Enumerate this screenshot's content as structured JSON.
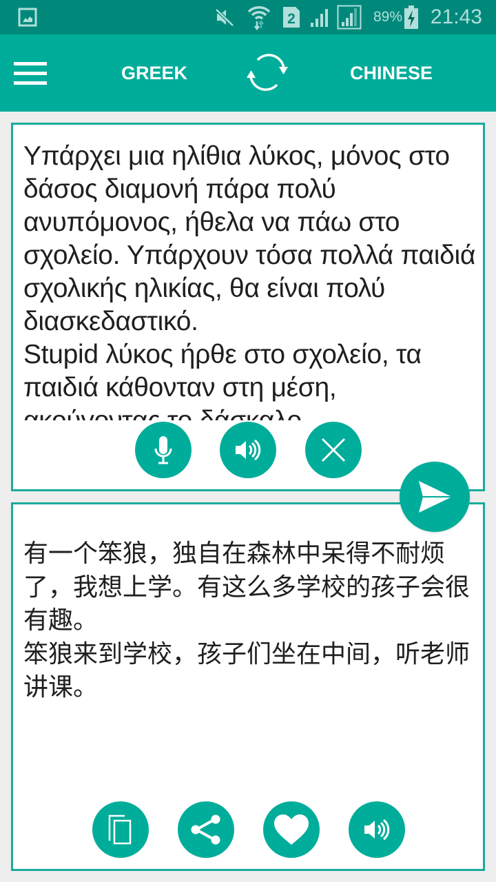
{
  "status_bar": {
    "notification_icon": "gallery-icon",
    "icons": [
      "mute-icon",
      "wifi-icon",
      "sim2-icon",
      "signal-icon",
      "signal-icon"
    ],
    "sim_label": "2",
    "battery_percent": "89%",
    "battery_icon": "battery-charging-icon",
    "time": "21:43"
  },
  "app_bar": {
    "menu_icon": "hamburger-menu-icon",
    "source_language": "GREEK",
    "swap_icon": "swap-languages-icon",
    "target_language": "CHINESE"
  },
  "source_panel": {
    "text": "Υπάρχει μια ηλίθια λύκος, μόνος στο δάσος διαμονή πάρα πολύ ανυπόμονος, ήθελα να πάω στο σχολείο. Υπάρχουν τόσα πολλά παιδιά σχολικής ηλικίας, θα είναι πολύ διασκεδαστικό.\nStupid λύκος ήρθε στο σχολείο, τα παιδιά κάθονταν στη μέση, ακούγοντας το δάσκαλο.",
    "buttons": [
      {
        "name": "microphone",
        "icon": "microphone-icon"
      },
      {
        "name": "speak-source",
        "icon": "speaker-icon"
      },
      {
        "name": "clear",
        "icon": "close-icon"
      }
    ]
  },
  "translate_button": {
    "icon": "send-icon"
  },
  "target_panel": {
    "text": "有一个笨狼，独自在森林中呆得不耐烦了，我想上学。有这么多学校的孩子会很有趣。\n笨狼来到学校，孩子们坐在中间，听老师讲课。",
    "buttons": [
      {
        "name": "copy",
        "icon": "copy-icon"
      },
      {
        "name": "share",
        "icon": "share-icon"
      },
      {
        "name": "favorite",
        "icon": "heart-icon"
      },
      {
        "name": "speak-target",
        "icon": "speaker-icon"
      }
    ]
  },
  "colors": {
    "status_bar": "#00897b",
    "app_bar": "#00ad9a",
    "accent": "#1aab9b",
    "background": "#eeeeee"
  }
}
